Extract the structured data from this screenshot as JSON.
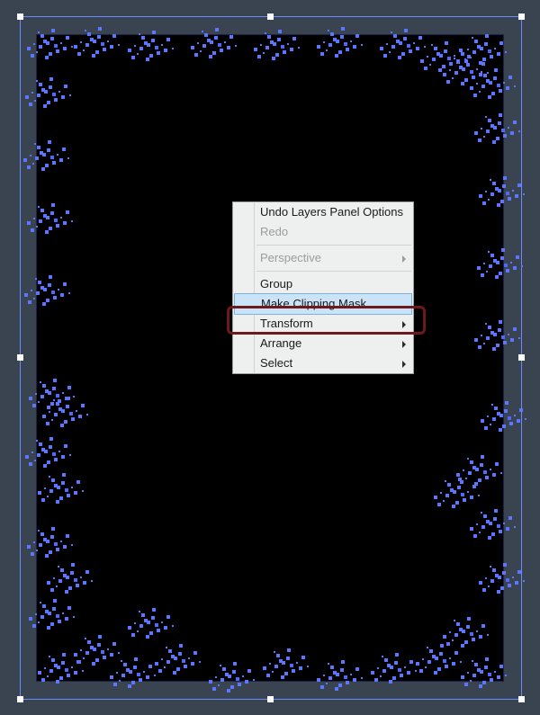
{
  "canvas": {
    "bg_color": "#3a4350",
    "selection_color": "#6a8bff",
    "speckle_color": "#5d76ff"
  },
  "context_menu": {
    "undo_label": "Undo Layers Panel Options",
    "redo_label": "Redo",
    "perspective_label": "Perspective",
    "group_label": "Group",
    "make_clipping_mask_label": "Make Clipping Mask",
    "transform_label": "Transform",
    "arrange_label": "Arrange",
    "select_label": "Select",
    "highlighted": "make_clipping_mask"
  },
  "callout": {
    "target": "make-clipping-mask-item",
    "color": "#6e1a1a"
  }
}
